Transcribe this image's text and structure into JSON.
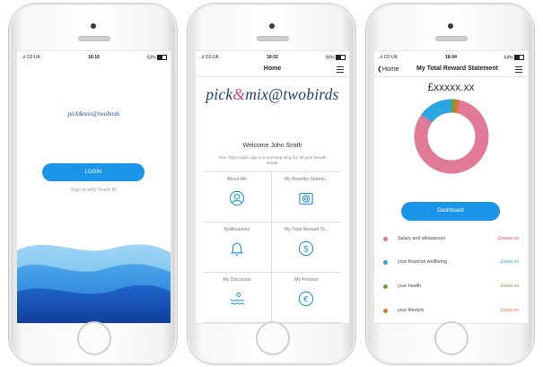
{
  "screen1": {
    "status": {
      "carrier": "..ıl O2-UK",
      "time": "18:16",
      "battery": "53%"
    },
    "logo": "pick&mix@twobirds",
    "login_label": "LOGIN",
    "touch_id_label": "Sign in with Touch ID"
  },
  "screen2": {
    "status": {
      "carrier": "..ıl O2-UK",
      "time": "18:02",
      "battery": "56%"
    },
    "nav_title": "Home",
    "brand": {
      "part1": "pick",
      "amp": "&",
      "part2": "mix@twobirds"
    },
    "welcome": "Welcome John Smith",
    "tagline": "Your TBS mobile app is a one-stop shop for all your benefit needs.",
    "tiles": [
      {
        "label": "About Me",
        "icon": "person-icon"
      },
      {
        "label": "My Benefits Statem...",
        "icon": "camera-icon"
      },
      {
        "label": "Notifications",
        "icon": "bell-icon"
      },
      {
        "label": "My Total Reward St...",
        "icon": "dollar-icon"
      },
      {
        "label": "My Discounts",
        "icon": "waves-person-icon"
      },
      {
        "label": "My Pension",
        "icon": "euro-icon"
      }
    ]
  },
  "screen3": {
    "status": {
      "carrier": "..ıl O2-UK",
      "time": "18:04",
      "battery": "64%"
    },
    "back_label": "Home",
    "nav_title": "My Total Reward Statement",
    "amount": "£xxxxx.xx",
    "dashboard_label": "Dashboard",
    "legend": [
      {
        "name": "Salary and allowances",
        "value": "£xxxxx.xx",
        "color": "#e07a97",
        "value_color": "#e0447a"
      },
      {
        "name": "your financial wellbeing",
        "value": "£xxxx.xx",
        "color": "#2aa6e0",
        "value_color": "#2aa6e0"
      },
      {
        "name": "your health",
        "value": "£xxxx.xx",
        "color": "#6aa329",
        "value_color": "#6aa329"
      },
      {
        "name": "your lifestyle",
        "value": "£xxxx.xx",
        "color": "#e8702c",
        "value_color": "#e8702c"
      }
    ]
  },
  "colors": {
    "accent": "#1b95e8",
    "brand_blue": "#1e3f7a",
    "brand_pink": "#e0447a"
  }
}
